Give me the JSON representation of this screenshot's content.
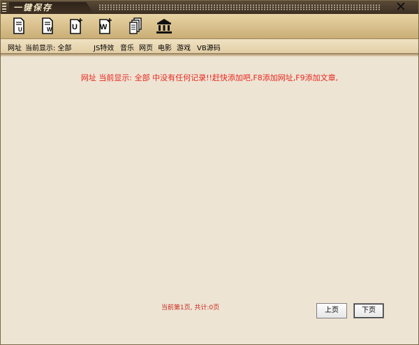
{
  "window": {
    "title": "一键保存"
  },
  "toolbar": {
    "icons": [
      {
        "name": "save-url-icon",
        "letter": "U"
      },
      {
        "name": "save-web-icon",
        "letter": "W"
      },
      {
        "name": "save-url-plus-icon",
        "letter": "U"
      },
      {
        "name": "save-word-icon",
        "letter": "W"
      },
      {
        "name": "copy-pages-icon",
        "letter": ""
      },
      {
        "name": "bank-icon",
        "letter": ""
      }
    ]
  },
  "categories": {
    "current_prefix": "网址",
    "current_label": "当前显示: 全部",
    "items": [
      "JS特效",
      "音乐",
      "网页",
      "电影",
      "游戏",
      "VB源码"
    ]
  },
  "content": {
    "empty_message": "网址 当前显示: 全部 中没有任何记录!!赶快添加吧,F8添加网址,F9添加文章,",
    "page_info": "当前第1页, 共计:0页",
    "prev_label": "上页",
    "next_label": "下页"
  }
}
